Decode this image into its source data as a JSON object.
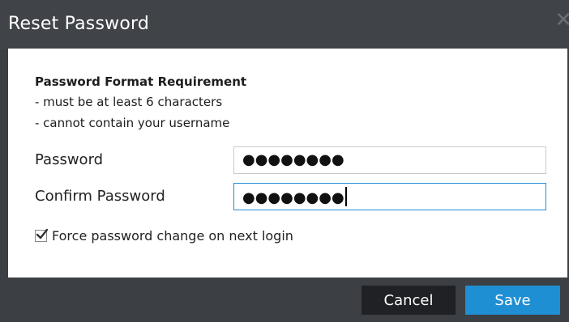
{
  "dialog": {
    "title": "Reset Password"
  },
  "requirements": {
    "heading": "Password Format Requirement",
    "lines": [
      "- must be at least 6 characters",
      "- cannot contain your username"
    ]
  },
  "fields": {
    "password": {
      "label": "Password",
      "value": "●●●●●●●●"
    },
    "confirm_password": {
      "label": "Confirm Password",
      "value": "●●●●●●●●"
    }
  },
  "force_change": {
    "label": "Force password change on next login",
    "checked": true
  },
  "buttons": {
    "cancel": "Cancel",
    "save": "Save"
  },
  "colors": {
    "accent": "#1f8fd4",
    "titlebar": "#404347",
    "footer": "#3c3f43",
    "cancel_bg": "#1f2124"
  }
}
